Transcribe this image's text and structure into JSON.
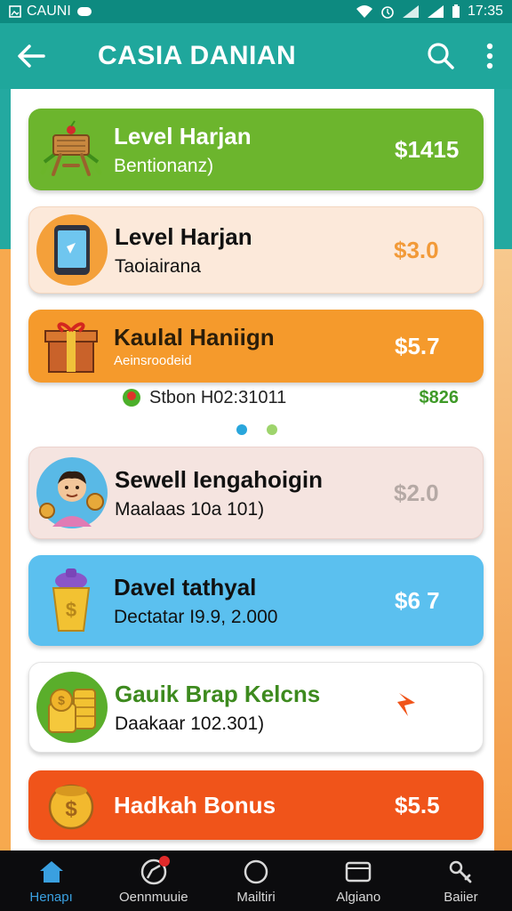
{
  "status_bar": {
    "carrier": "CAUNI",
    "time": "17:35"
  },
  "app_bar": {
    "title": "CASIA DANIAN"
  },
  "cards": [
    {
      "title": "Level Harjan",
      "subtitle": "Bentionanz)",
      "amount": "$1415",
      "icon": "wooden-cart-icon"
    },
    {
      "title": "Level Harjan",
      "subtitle": "Taoiairana",
      "amount": "$3.0",
      "icon": "tablet-icon"
    },
    {
      "title": "Kaulal Haniign",
      "subtitle": "Aeinsroodeid",
      "amount": "$5.7",
      "icon": "gift-box-icon"
    },
    {
      "title": "Sewell Iengahoigin",
      "subtitle": "Maalaas 10a 101)",
      "amount": "$2.0",
      "icon": "avatar-coin-icon"
    },
    {
      "title": "Davel tathyal",
      "subtitle": "Dectatar I9.9, 2.000",
      "amount": "$6 7",
      "icon": "cup-icon"
    },
    {
      "title": "Gauik Brap Kelcns",
      "subtitle": "Daakaar 102.301)",
      "amount": "",
      "icon": "coin-stack-icon"
    },
    {
      "title": "Hadkah Bonus",
      "subtitle": "",
      "amount": "$5.5",
      "icon": "coin-pot-icon"
    }
  ],
  "sub_row": {
    "label": "Stbon H02:31011",
    "value": "$826"
  },
  "colors": {
    "teal": "#1fa79c",
    "green": "#6cb52d",
    "orange": "#f59a2c",
    "blue": "#5bc0ef",
    "red_orange": "#f0541a",
    "dot_active": "#29a6dc",
    "dot_inactive": "#9ed46c"
  },
  "bottom_nav": [
    {
      "label": "Henapı",
      "icon": "home-icon",
      "active": true
    },
    {
      "label": "Oennmuuie",
      "icon": "compass-icon",
      "active": false
    },
    {
      "label": "Mailtiri",
      "icon": "circle-icon",
      "active": false
    },
    {
      "label": "Algiano",
      "icon": "wallet-icon",
      "active": false
    },
    {
      "label": "Baiier",
      "icon": "tools-icon",
      "active": false
    }
  ]
}
